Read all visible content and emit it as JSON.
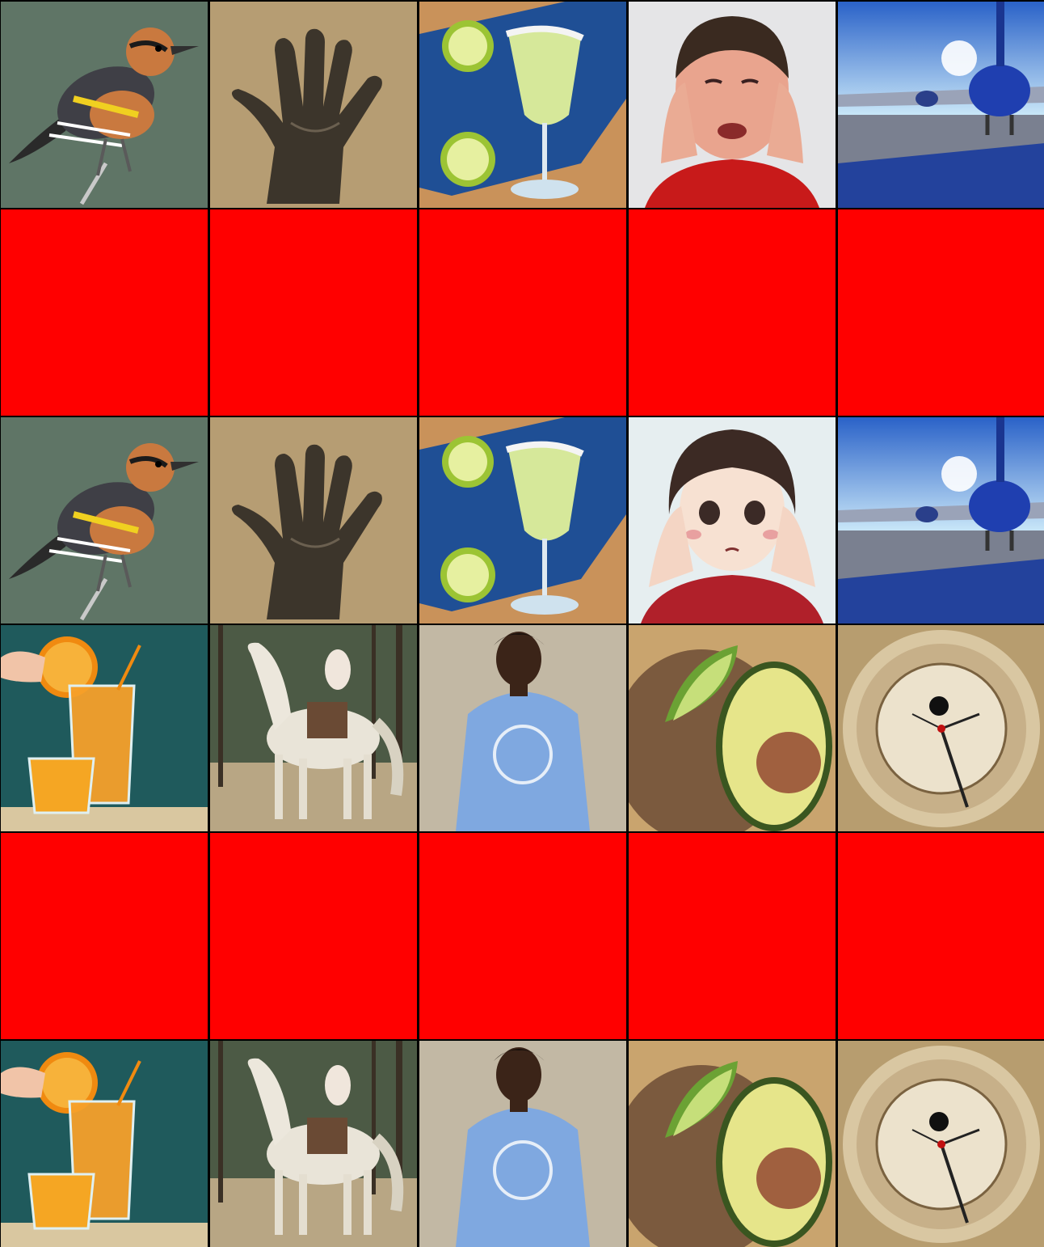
{
  "grid": {
    "rows": 6,
    "columns": 5,
    "blocked_color": "#ff0000",
    "cells": [
      {
        "row": 1,
        "col": 1,
        "kind": "image",
        "subject": "bird-photo"
      },
      {
        "row": 1,
        "col": 2,
        "kind": "image",
        "subject": "hand-photo"
      },
      {
        "row": 1,
        "col": 3,
        "kind": "image",
        "subject": "margarita-photo"
      },
      {
        "row": 1,
        "col": 4,
        "kind": "image",
        "subject": "crying-boy-photo"
      },
      {
        "row": 1,
        "col": 5,
        "kind": "image",
        "subject": "airplane-photo"
      },
      {
        "row": 2,
        "col": 1,
        "kind": "blocked"
      },
      {
        "row": 2,
        "col": 2,
        "kind": "blocked"
      },
      {
        "row": 2,
        "col": 3,
        "kind": "blocked"
      },
      {
        "row": 2,
        "col": 4,
        "kind": "blocked"
      },
      {
        "row": 2,
        "col": 5,
        "kind": "blocked"
      },
      {
        "row": 3,
        "col": 1,
        "kind": "image",
        "subject": "bird-illustration"
      },
      {
        "row": 3,
        "col": 2,
        "kind": "image",
        "subject": "hand-illustration"
      },
      {
        "row": 3,
        "col": 3,
        "kind": "image",
        "subject": "margarita-illustration"
      },
      {
        "row": 3,
        "col": 4,
        "kind": "image",
        "subject": "anime-boy-illustration"
      },
      {
        "row": 3,
        "col": 5,
        "kind": "image",
        "subject": "airplane-illustration"
      },
      {
        "row": 4,
        "col": 1,
        "kind": "image",
        "subject": "orange-juice-photo"
      },
      {
        "row": 4,
        "col": 2,
        "kind": "image",
        "subject": "white-horse-rider-photo"
      },
      {
        "row": 4,
        "col": 3,
        "kind": "image",
        "subject": "man-blue-tshirt-photo"
      },
      {
        "row": 4,
        "col": 4,
        "kind": "image",
        "subject": "avocado-photo"
      },
      {
        "row": 4,
        "col": 5,
        "kind": "image",
        "subject": "clock-photo"
      },
      {
        "row": 5,
        "col": 1,
        "kind": "blocked"
      },
      {
        "row": 5,
        "col": 2,
        "kind": "blocked"
      },
      {
        "row": 5,
        "col": 3,
        "kind": "blocked"
      },
      {
        "row": 5,
        "col": 4,
        "kind": "blocked"
      },
      {
        "row": 5,
        "col": 5,
        "kind": "blocked"
      },
      {
        "row": 6,
        "col": 1,
        "kind": "image",
        "subject": "orange-juice-illustration"
      },
      {
        "row": 6,
        "col": 2,
        "kind": "image",
        "subject": "white-horse-illustration"
      },
      {
        "row": 6,
        "col": 3,
        "kind": "image",
        "subject": "man-blue-tshirt-illustration"
      },
      {
        "row": 6,
        "col": 4,
        "kind": "image",
        "subject": "avocado-illustration"
      },
      {
        "row": 6,
        "col": 5,
        "kind": "image",
        "subject": "clock-illustration"
      }
    ]
  }
}
